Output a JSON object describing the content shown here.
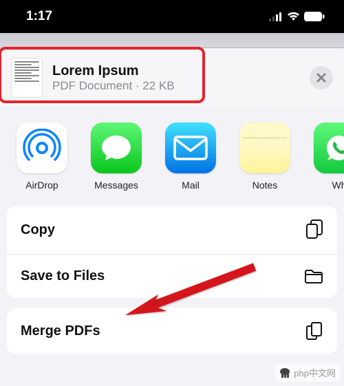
{
  "status": {
    "time": "1:17"
  },
  "document": {
    "title": "Lorem Ipsum",
    "subtitle": "PDF Document · 22 KB"
  },
  "apps": {
    "airdrop": "AirDrop",
    "messages": "Messages",
    "mail": "Mail",
    "notes": "Notes",
    "whatsapp": "Wh"
  },
  "actions": {
    "copy": "Copy",
    "save_to_files": "Save to Files",
    "merge_pdfs": "Merge PDFs"
  },
  "watermark": "php中文网"
}
